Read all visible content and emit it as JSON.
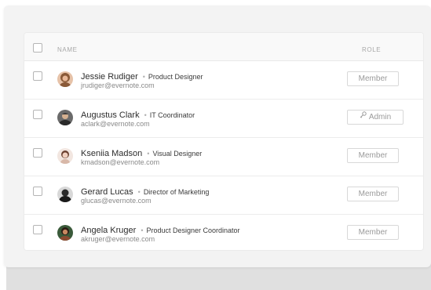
{
  "header": {
    "name_label": "NAME",
    "role_label": "ROLE"
  },
  "users": [
    {
      "name": "Jessie Rudiger",
      "title": "Product Designer",
      "email": "jrudiger@evernote.com",
      "role": "Member",
      "role_icon": null,
      "avatar_colors": [
        "#d9a07a",
        "#7a4a2e"
      ]
    },
    {
      "name": "Augustus Clark",
      "title": "IT Coordinator",
      "email": "aclark@evernote.com",
      "role": "Admin",
      "role_icon": "key-icon",
      "avatar_colors": [
        "#5a5a5a",
        "#2a2a2a"
      ]
    },
    {
      "name": "Kseniia Madson",
      "title": "Visual Designer",
      "email": "kmadson@evernote.com",
      "role": "Member",
      "role_icon": null,
      "avatar_colors": [
        "#f0d5c8",
        "#b07a68"
      ]
    },
    {
      "name": "Gerard Lucas",
      "title": "Director of Marketing",
      "email": "glucas@evernote.com",
      "role": "Member",
      "role_icon": null,
      "avatar_colors": [
        "#3a3a3a",
        "#1a1a1a"
      ]
    },
    {
      "name": "Angela Kruger",
      "title": "Product Designer Coordinator",
      "email": "akruger@evernote.com",
      "role": "Member",
      "role_icon": null,
      "avatar_colors": [
        "#4a6a4a",
        "#c07050"
      ]
    }
  ]
}
